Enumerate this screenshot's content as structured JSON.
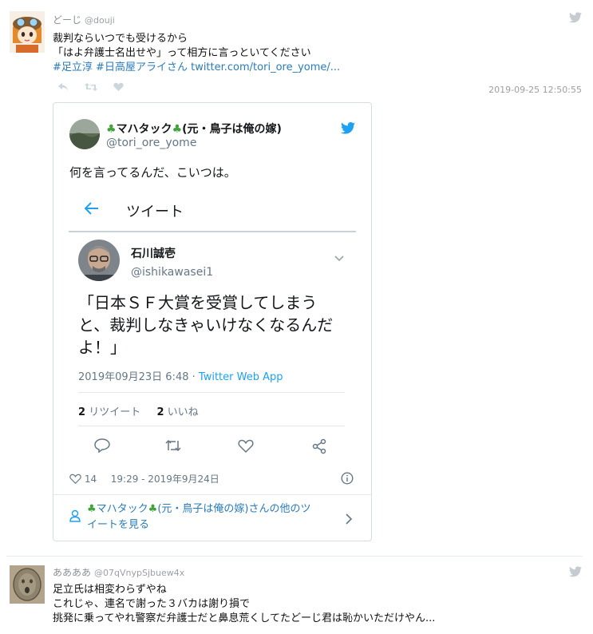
{
  "tweet": {
    "display_name": "どーじ",
    "handle": "@douji",
    "line1": "裁判ならいつでも受けるから",
    "line2": "「はよ弁護士名出せや」って相方に言っといてください",
    "hashtag1": "#足立淳",
    "hashtag2": "#日高屋アライさん",
    "link": "twitter.com/tori_ore_yome/...",
    "timestamp": "2019-09-25 12:50:55"
  },
  "embed": {
    "name": "マハタック",
    "name_suffix": "(元・鳥子は俺の嫁)",
    "handle": "@tori_ore_yome",
    "text": "何を言ってるんだ、こいつは。",
    "screenshot": {
      "header": "ツイート",
      "author_name": "石川誠壱",
      "author_handle": "@ishikawasei1",
      "quote": "「日本ＳＦ大賞を受賞してしまうと、裁判しなきゃいけなくなるんだよ！」",
      "date": "2019年09月23日 6:48",
      "source": "Twitter Web App",
      "rt_count": "2",
      "rt_label": "リツイート",
      "like_count": "2",
      "like_label": "いいね"
    },
    "like_count": "14",
    "datetime": "19:29 - 2019年9月24日",
    "footer_name": "マハタック",
    "footer_text_a": "(元・鳥子は俺の嫁)さんの他のツ",
    "footer_text_b": "イートを見る"
  },
  "reply": {
    "display_name": "ああああ",
    "handle": "@07qVnypSjbuew4x",
    "line1": "足立氏は相変わらずやね",
    "line2": "これじゃ、連名で謝った３バカは謝り損で",
    "line3": "挑発に乗ってやれ警察だ弁護士だと鼻息荒くしてたどーじ君は恥かいただけやん..."
  },
  "colors": {
    "twitter_blue": "#1da1f2",
    "link_blue": "#2b7bb9",
    "clover_green": "#3fa23a"
  }
}
